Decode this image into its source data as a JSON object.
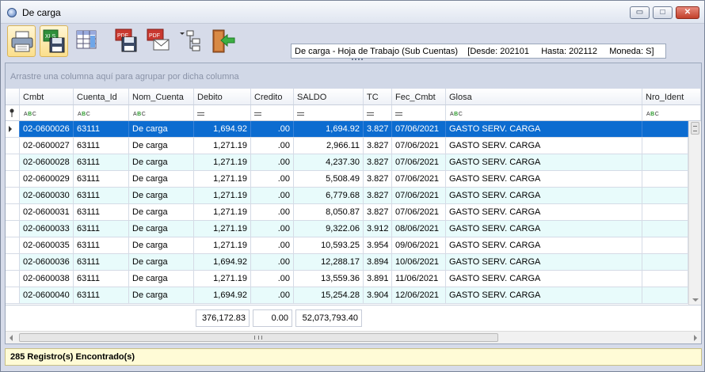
{
  "window": {
    "title": "De carga",
    "controls": {
      "minimize": "▭",
      "maximize": "□",
      "close": "✕"
    }
  },
  "toolbar": {
    "buttons": [
      {
        "name": "printer-icon"
      },
      {
        "name": "export-xls-icon",
        "label": "XLS"
      },
      {
        "name": "column-chooser-icon"
      },
      {
        "name": "export-pdf-icon",
        "label": "PDF"
      },
      {
        "name": "email-pdf-icon",
        "label": "PDF"
      },
      {
        "name": "tree-view-icon"
      },
      {
        "name": "exit-door-icon"
      }
    ],
    "info": "De carga - Hoja de Trabajo (Sub Cuentas)    [Desde: 202101     Hasta: 202112     Moneda: S]"
  },
  "grid": {
    "group_panel_text": "Arrastre una columna aquí para agrupar por dicha columna",
    "columns": [
      "Cmbt",
      "Cuenta_Id",
      "Nom_Cuenta",
      "Debito",
      "Credito",
      "SALDO",
      "TC",
      "Fec_Cmbt",
      "Glosa",
      "Nro_Ident"
    ],
    "filter_row": [
      "ABC",
      "ABC",
      "ABC",
      "=",
      "=",
      "=",
      "=",
      "=",
      "ABC",
      "ABC"
    ],
    "rows": [
      [
        "02-0600026",
        "63111",
        "De carga",
        "1,694.92",
        ".00",
        "1,694.92",
        "3.827",
        "07/06/2021",
        "GASTO SERV. CARGA",
        ""
      ],
      [
        "02-0600027",
        "63111",
        "De carga",
        "1,271.19",
        ".00",
        "2,966.11",
        "3.827",
        "07/06/2021",
        "GASTO SERV. CARGA",
        ""
      ],
      [
        "02-0600028",
        "63111",
        "De carga",
        "1,271.19",
        ".00",
        "4,237.30",
        "3.827",
        "07/06/2021",
        "GASTO SERV. CARGA",
        ""
      ],
      [
        "02-0600029",
        "63111",
        "De carga",
        "1,271.19",
        ".00",
        "5,508.49",
        "3.827",
        "07/06/2021",
        "GASTO SERV. CARGA",
        ""
      ],
      [
        "02-0600030",
        "63111",
        "De carga",
        "1,271.19",
        ".00",
        "6,779.68",
        "3.827",
        "07/06/2021",
        "GASTO SERV. CARGA",
        ""
      ],
      [
        "02-0600031",
        "63111",
        "De carga",
        "1,271.19",
        ".00",
        "8,050.87",
        "3.827",
        "07/06/2021",
        "GASTO SERV. CARGA",
        ""
      ],
      [
        "02-0600033",
        "63111",
        "De carga",
        "1,271.19",
        ".00",
        "9,322.06",
        "3.912",
        "08/06/2021",
        "GASTO SERV. CARGA",
        ""
      ],
      [
        "02-0600035",
        "63111",
        "De carga",
        "1,271.19",
        ".00",
        "10,593.25",
        "3.954",
        "09/06/2021",
        "GASTO SERV. CARGA",
        ""
      ],
      [
        "02-0600036",
        "63111",
        "De carga",
        "1,694.92",
        ".00",
        "12,288.17",
        "3.894",
        "10/06/2021",
        "GASTO SERV. CARGA",
        ""
      ],
      [
        "02-0600038",
        "63111",
        "De carga",
        "1,271.19",
        ".00",
        "13,559.36",
        "3.891",
        "11/06/2021",
        "GASTO SERV. CARGA",
        ""
      ],
      [
        "02-0600040",
        "63111",
        "De carga",
        "1,694.92",
        ".00",
        "15,254.28",
        "3.904",
        "12/06/2021",
        "GASTO SERV. CARGA",
        ""
      ]
    ],
    "selected_row": 0,
    "totals": {
      "debito": "376,172.83",
      "credito": "0.00",
      "saldo": "52,073,793.40"
    },
    "scroll_grip": "III"
  },
  "status": {
    "text": "285 Registro(s) Encontrado(s)"
  },
  "colors": {
    "selection": "#0c6cd0",
    "alt_row": "#e8fbfb",
    "status_bg": "#fffbd6"
  }
}
